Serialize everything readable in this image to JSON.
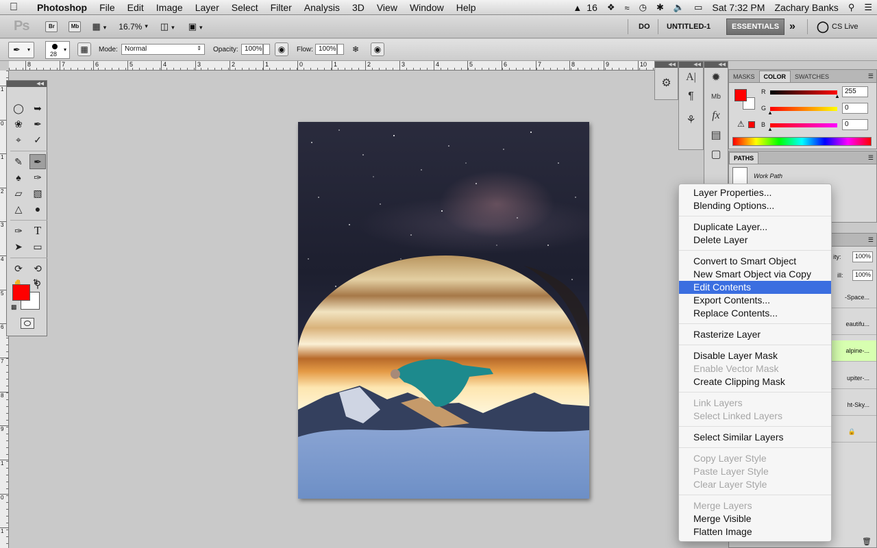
{
  "menubar": {
    "app_name": "Photoshop",
    "items": [
      "File",
      "Edit",
      "Image",
      "Layer",
      "Select",
      "Filter",
      "Analysis",
      "3D",
      "View",
      "Window",
      "Help"
    ],
    "status": {
      "adobe_count": "16",
      "clock": "Sat 7:32 PM",
      "user": "Zachary Banks"
    }
  },
  "appbar": {
    "logo": "Ps",
    "bridge_label": "Br",
    "minibridge_label": "Mb",
    "zoom": "16.7%",
    "workspaces": [
      "DO",
      "UNTITLED-1",
      "ESSENTIALS"
    ],
    "more": "»",
    "cslive": "CS Live"
  },
  "options": {
    "brush_size": "28",
    "mode_label": "Mode:",
    "mode_value": "Normal",
    "opacity_label": "Opacity:",
    "opacity_value": "100%",
    "flow_label": "Flow:",
    "flow_value": "100%"
  },
  "ruler_top": [
    "8",
    "7",
    "6",
    "5",
    "4",
    "3",
    "2",
    "1",
    "0",
    "1",
    "2",
    "3",
    "4",
    "5",
    "6",
    "7",
    "8",
    "9",
    "10"
  ],
  "ruler_left": [
    "1",
    "0",
    "1",
    "2",
    "3",
    "4",
    "5",
    "6",
    "7",
    "8",
    "9",
    "1",
    "0",
    "1"
  ],
  "colors": {
    "foreground": "#ff0000",
    "background": "#ffffff",
    "menu_highlight": "#3b6ee0"
  },
  "color_panel": {
    "tabs": [
      "MASKS",
      "COLOR",
      "SWATCHES"
    ],
    "r_label": "R",
    "r_value": "255",
    "g_label": "G",
    "g_value": "0",
    "b_label": "B",
    "b_value": "0"
  },
  "paths_panel": {
    "tab": "PATHS",
    "work_path": "Work Path"
  },
  "layers_panel": {
    "opacity_suffix": "ity:",
    "opacity_value": "100%",
    "fill_suffix": "ill:",
    "fill_value": "100%",
    "layer_names": [
      "-Space...",
      "eautifu...",
      "alpine-...",
      "upiter-...",
      "ht-Sky..."
    ]
  },
  "context_menu": {
    "groups": [
      [
        {
          "label": "Layer Properties...",
          "enabled": true
        },
        {
          "label": "Blending Options...",
          "enabled": true
        }
      ],
      [
        {
          "label": "Duplicate Layer...",
          "enabled": true
        },
        {
          "label": "Delete Layer",
          "enabled": true
        }
      ],
      [
        {
          "label": "Convert to Smart Object",
          "enabled": true
        },
        {
          "label": "New Smart Object via Copy",
          "enabled": true
        },
        {
          "label": "Edit Contents",
          "enabled": true,
          "highlighted": true
        },
        {
          "label": "Export Contents...",
          "enabled": true
        },
        {
          "label": "Replace Contents...",
          "enabled": true
        }
      ],
      [
        {
          "label": "Rasterize Layer",
          "enabled": true
        }
      ],
      [
        {
          "label": "Disable Layer Mask",
          "enabled": true
        },
        {
          "label": "Enable Vector Mask",
          "enabled": false
        },
        {
          "label": "Create Clipping Mask",
          "enabled": true
        }
      ],
      [
        {
          "label": "Link Layers",
          "enabled": false
        },
        {
          "label": "Select Linked Layers",
          "enabled": false
        }
      ],
      [
        {
          "label": "Select Similar Layers",
          "enabled": true
        }
      ],
      [
        {
          "label": "Copy Layer Style",
          "enabled": false
        },
        {
          "label": "Paste Layer Style",
          "enabled": false
        },
        {
          "label": "Clear Layer Style",
          "enabled": false
        }
      ],
      [
        {
          "label": "Merge Layers",
          "enabled": false
        },
        {
          "label": "Merge Visible",
          "enabled": true
        },
        {
          "label": "Flatten Image",
          "enabled": true
        }
      ]
    ]
  }
}
